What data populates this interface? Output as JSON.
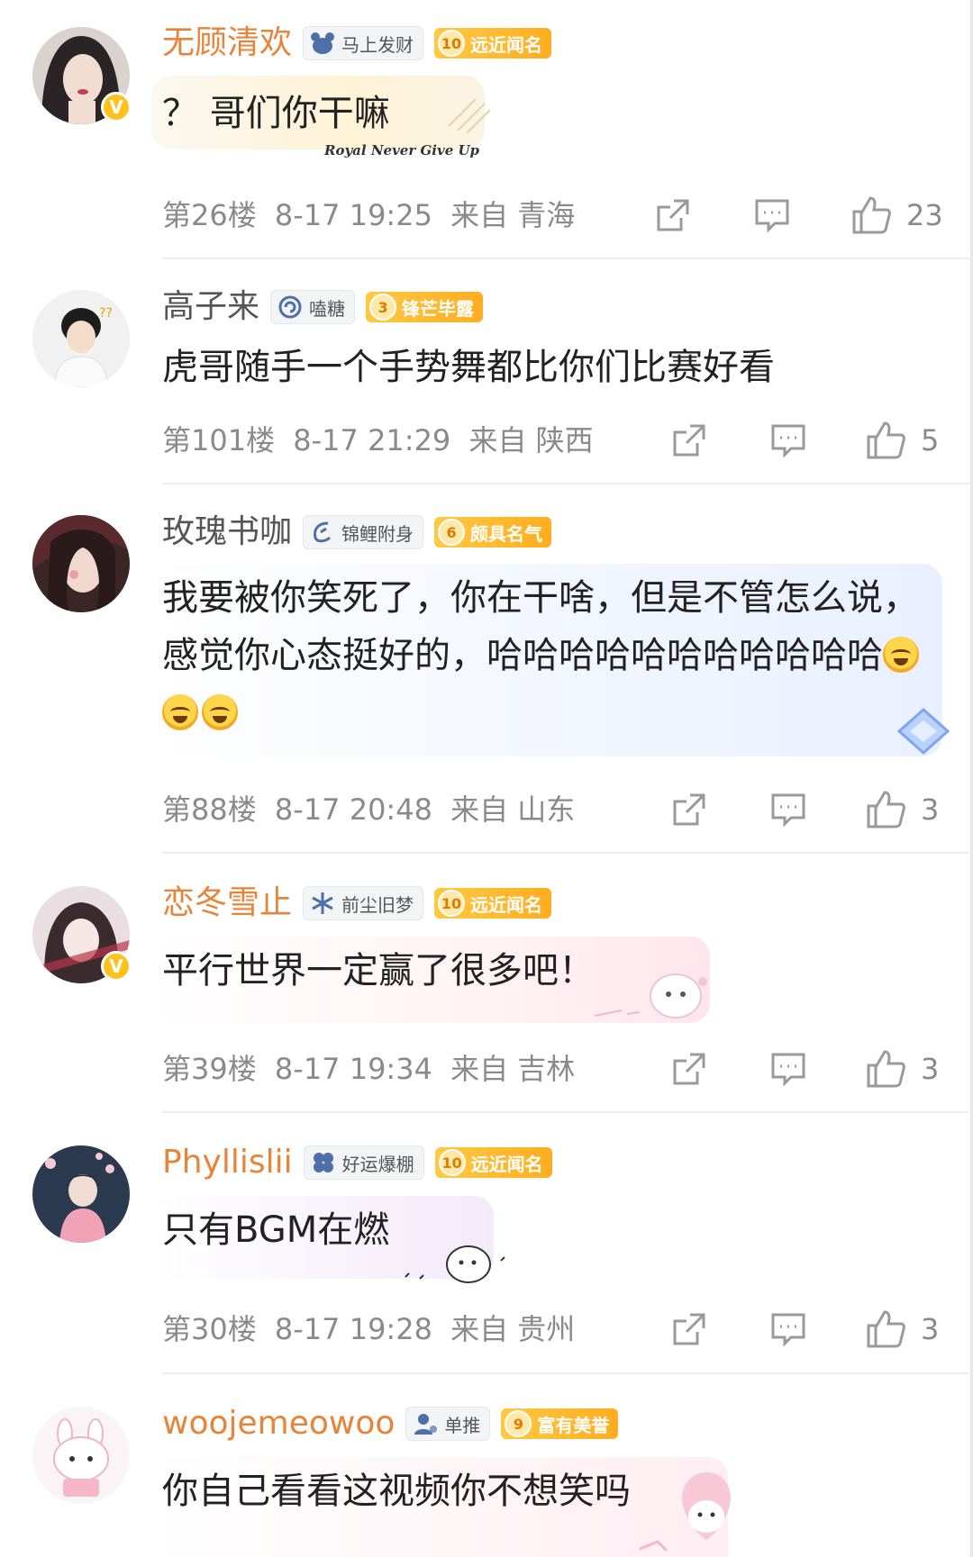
{
  "actions": {
    "repost_icon": "share-box-icon",
    "reply_icon": "comment-icon",
    "like_icon": "thumbs-up-icon"
  },
  "comments": [
    {
      "username": "无顾清欢",
      "user_color": "#e8833a",
      "verified": true,
      "fan_tag": "马上发财",
      "fan_tag_icon": "bear-icon",
      "level": "10",
      "level_title": "远近闻名",
      "text": "？ 哥们你干嘛",
      "bubble_caption": "Royal Never Give Up",
      "floor": "第26楼",
      "time": "8-17 19:25",
      "location": "来自 青海",
      "likes": "23"
    },
    {
      "username": "高子来",
      "user_color": "#555555",
      "verified": false,
      "fan_tag": "嗑糖",
      "fan_tag_icon": "lollipop-icon",
      "level": "3",
      "level_title": "锋芒毕露",
      "text": "虎哥随手一个手势舞都比你们比赛好看",
      "floor": "第101楼",
      "time": "8-17 21:29",
      "location": "来自 陕西",
      "likes": "5"
    },
    {
      "username": "玫瑰书咖",
      "user_color": "#555555",
      "verified": false,
      "fan_tag": "锦鲤附身",
      "fan_tag_icon": "koi-icon",
      "level": "6",
      "level_title": "颇具名气",
      "text": "我要被你笑死了，你在干啥，但是不管怎么说，感觉你心态挺好的，哈哈哈哈哈哈哈哈哈哈哈",
      "emoji_count": 3,
      "emoji_name": "laugh-cry-emoji",
      "floor": "第88楼",
      "time": "8-17 20:48",
      "location": "来自 山东",
      "likes": "3"
    },
    {
      "username": "恋冬雪止",
      "user_color": "#e8833a",
      "verified": true,
      "fan_tag": "前尘旧梦",
      "fan_tag_icon": "snowflake-icon",
      "level": "10",
      "level_title": "远近闻名",
      "text": "平行世界一定赢了很多吧！",
      "floor": "第39楼",
      "time": "8-17 19:34",
      "location": "来自 吉林",
      "likes": "3"
    },
    {
      "username": "Phyllislii",
      "user_color": "#e8833a",
      "verified": false,
      "fan_tag": "好运爆棚",
      "fan_tag_icon": "clover-icon",
      "level": "10",
      "level_title": "远近闻名",
      "text": "只有BGM在燃",
      "floor": "第30楼",
      "time": "8-17 19:28",
      "location": "来自 贵州",
      "likes": "3"
    },
    {
      "username": "woojemeowoo",
      "user_color": "#e8833a",
      "verified": false,
      "fan_tag": "单推",
      "fan_tag_icon": "person-icon",
      "level": "9",
      "level_title": "富有美誉",
      "text": "你自己看看这视频你不想笑吗"
    }
  ]
}
